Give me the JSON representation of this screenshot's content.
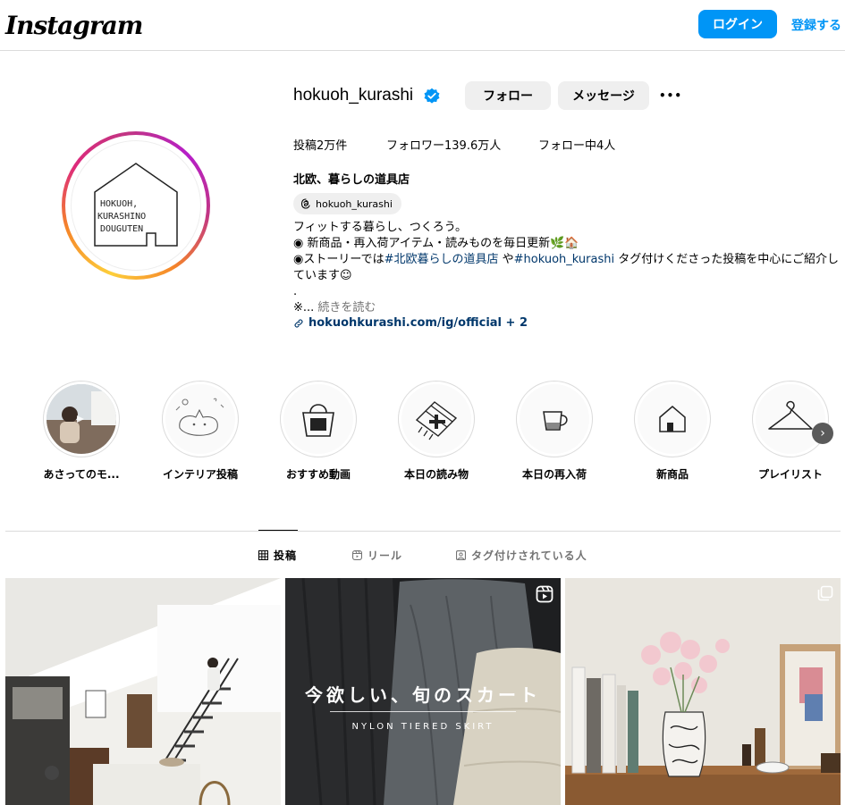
{
  "nav": {
    "logo": "Instagram",
    "login_label": "ログイン",
    "signup_label": "登録する"
  },
  "profile": {
    "username": "hokuoh_kurashi",
    "follow_label": "フォロー",
    "message_label": "メッセージ",
    "more_label": "•••",
    "stats": {
      "posts": "投稿2万件",
      "followers": "フォロワー139.6万人",
      "following": "フォロー中4人"
    },
    "full_name": "北欧、暮らしの道具店",
    "threads_handle": "hokuoh_kurashi",
    "bio": {
      "line1": "フィットする暮らし、つくろう。",
      "line2": "◉ 新商品・再入荷アイテム・読みものを毎日更新🌿🏠",
      "line3_pre": "◉ストーリーでは",
      "line3_tag1": "#北欧暮らしの道具店",
      "line3_mid": " や",
      "line3_tag2": "#hokuoh_kurashi",
      "line3_post": " タグ付けくださった投稿を中心にご紹介しています☺",
      "line4": ".",
      "line5_pre": "※...",
      "line5_more": " 続きを読む"
    },
    "link_text": "hokuohkurashi.com/ig/official + 2",
    "avatar_text": [
      "HOKUOH,",
      "KURASHINO",
      "DOUGUTEN"
    ]
  },
  "highlights": [
    {
      "label": "あさってのモ...",
      "icon": "video-thumbnail"
    },
    {
      "label": "インテリア投稿",
      "icon": "cat-drawing-icon"
    },
    {
      "label": "おすすめ動画",
      "icon": "tote-bag-icon"
    },
    {
      "label": "本日の読み物",
      "icon": "book-icon"
    },
    {
      "label": "本日の再入荷",
      "icon": "cup-icon"
    },
    {
      "label": "新商品",
      "icon": "house-icon"
    },
    {
      "label": "プレイリスト",
      "icon": "hanger-icon"
    }
  ],
  "tabs": [
    {
      "label": "投稿",
      "icon": "grid-icon",
      "active": true
    },
    {
      "label": "リール",
      "icon": "reels-icon",
      "active": false
    },
    {
      "label": "タグ付けされている人",
      "icon": "tagged-icon",
      "active": false
    }
  ],
  "posts": {
    "post2_title": "今欲しい、旬のスカート",
    "post2_subtitle": "NYLON TIERED SKIRT"
  },
  "colors": {
    "accent": "#0095f6",
    "link": "#00376b",
    "verified": "#0095f6"
  }
}
